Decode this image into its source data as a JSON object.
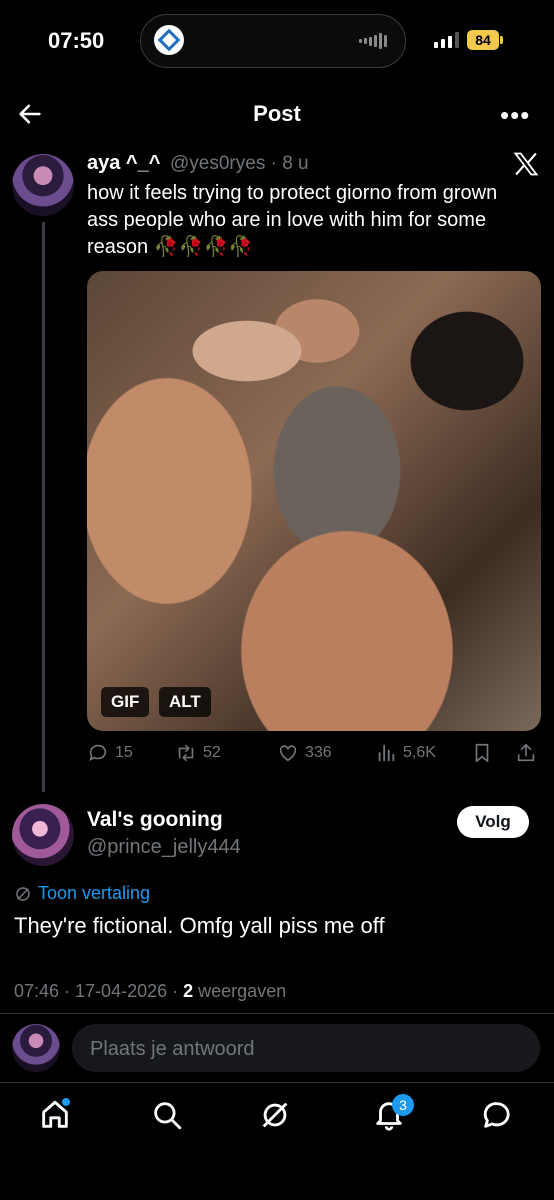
{
  "status_bar": {
    "time": "07:50",
    "battery": "84"
  },
  "header": {
    "title": "Post"
  },
  "quoted_post": {
    "display_name": "aya ^_^",
    "handle": "@yes0ryes · 8 u",
    "text": "how it feels trying to protect giorno from grown ass people who are in love with him for some reason 🥀🥀🥀🥀",
    "media_badges": {
      "gif": "GIF",
      "alt": "ALT"
    },
    "stats": {
      "replies": "15",
      "reposts": "52",
      "likes": "336",
      "views": "5,6K"
    }
  },
  "reply_post": {
    "display_name": "Val's gooning",
    "handle": "@prince_jelly444",
    "follow_label": "Volg",
    "translate_label": "Toon vertaling",
    "text": "They're fictional. Omfg yall piss me off",
    "timestamp": "07:46 · 17-04-2026 ·",
    "views_count": "2",
    "views_label": "weergaven"
  },
  "composer": {
    "placeholder": "Plaats je antwoord"
  },
  "bottom_nav": {
    "notifications_count": "3"
  },
  "colors": {
    "accent": "#1d9bf0",
    "background": "#000000",
    "muted": "#71767b"
  },
  "icons": [
    "back-arrow-icon",
    "more-icon",
    "x-logo-icon",
    "reply-icon",
    "repost-icon",
    "like-icon",
    "views-icon",
    "bookmark-icon",
    "share-icon",
    "translate-icon",
    "home-icon",
    "search-icon",
    "grok-icon",
    "notifications-icon",
    "messages-icon"
  ]
}
